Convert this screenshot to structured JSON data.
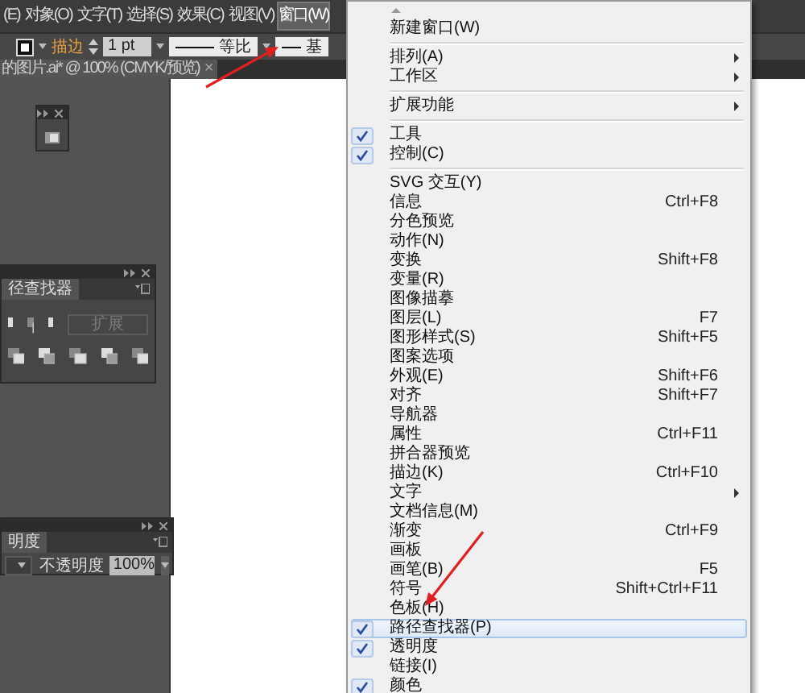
{
  "menubar": {
    "items": [
      {
        "label": "(E)",
        "selected": false
      },
      {
        "label": "对象(O)",
        "selected": false
      },
      {
        "label": "文字(T)",
        "selected": false
      },
      {
        "label": "选择(S)",
        "selected": false
      },
      {
        "label": "效果(C)",
        "selected": false
      },
      {
        "label": "视图(V)",
        "selected": false
      },
      {
        "label": "窗口(W)",
        "selected": true
      }
    ]
  },
  "control_bar": {
    "stroke_label": "描边",
    "stroke_weight": "1 pt",
    "profile_1": "等比",
    "profile_2": "基"
  },
  "document_tab": {
    "title": "的图片.ai* @ 100% (CMYK/预览)",
    "close": "×"
  },
  "pathfinder_panel": {
    "tab": "径查找器",
    "expand_button": {
      "label": "扩展",
      "disabled": true
    }
  },
  "transparency_panel": {
    "tab": "明度",
    "opacity_label": "不透明度",
    "opacity_value": "100%"
  },
  "window_menu": {
    "items": [
      {
        "kind": "item",
        "label": "新建窗口(W)",
        "checked": false,
        "selected": false
      },
      {
        "kind": "separator"
      },
      {
        "kind": "item",
        "label": "排列(A)",
        "submenu": true,
        "checked": false,
        "selected": false
      },
      {
        "kind": "item",
        "label": "工作区",
        "submenu": true,
        "checked": false,
        "selected": false
      },
      {
        "kind": "separator"
      },
      {
        "kind": "item",
        "label": "扩展功能",
        "submenu": true,
        "checked": false,
        "selected": false
      },
      {
        "kind": "separator"
      },
      {
        "kind": "item",
        "label": "工具",
        "checked": true,
        "selected": false
      },
      {
        "kind": "item",
        "label": "控制(C)",
        "checked": true,
        "selected": false
      },
      {
        "kind": "separator"
      },
      {
        "kind": "item",
        "label": "SVG 交互(Y)",
        "checked": false,
        "selected": false
      },
      {
        "kind": "item",
        "label": "信息",
        "shortcut": "Ctrl+F8",
        "checked": false,
        "selected": false
      },
      {
        "kind": "item",
        "label": "分色预览",
        "checked": false,
        "selected": false
      },
      {
        "kind": "item",
        "label": "动作(N)",
        "checked": false,
        "selected": false
      },
      {
        "kind": "item",
        "label": "变换",
        "shortcut": "Shift+F8",
        "checked": false,
        "selected": false
      },
      {
        "kind": "item",
        "label": "变量(R)",
        "checked": false,
        "selected": false
      },
      {
        "kind": "item",
        "label": "图像描摹",
        "checked": false,
        "selected": false
      },
      {
        "kind": "item",
        "label": "图层(L)",
        "shortcut": "F7",
        "checked": false,
        "selected": false
      },
      {
        "kind": "item",
        "label": "图形样式(S)",
        "shortcut": "Shift+F5",
        "checked": false,
        "selected": false
      },
      {
        "kind": "item",
        "label": "图案选项",
        "checked": false,
        "selected": false
      },
      {
        "kind": "item",
        "label": "外观(E)",
        "shortcut": "Shift+F6",
        "checked": false,
        "selected": false
      },
      {
        "kind": "item",
        "label": "对齐",
        "shortcut": "Shift+F7",
        "checked": false,
        "selected": false
      },
      {
        "kind": "item",
        "label": "导航器",
        "checked": false,
        "selected": false
      },
      {
        "kind": "item",
        "label": "属性",
        "shortcut": "Ctrl+F11",
        "checked": false,
        "selected": false
      },
      {
        "kind": "item",
        "label": "拼合器预览",
        "checked": false,
        "selected": false
      },
      {
        "kind": "item",
        "label": "描边(K)",
        "shortcut": "Ctrl+F10",
        "checked": false,
        "selected": false
      },
      {
        "kind": "item",
        "label": "文字",
        "submenu": true,
        "checked": false,
        "selected": false
      },
      {
        "kind": "item",
        "label": "文档信息(M)",
        "checked": false,
        "selected": false
      },
      {
        "kind": "item",
        "label": "渐变",
        "shortcut": "Ctrl+F9",
        "checked": false,
        "selected": false
      },
      {
        "kind": "item",
        "label": "画板",
        "checked": false,
        "selected": false
      },
      {
        "kind": "item",
        "label": "画笔(B)",
        "shortcut": "F5",
        "checked": false,
        "selected": false
      },
      {
        "kind": "item",
        "label": "符号",
        "shortcut": "Shift+Ctrl+F11",
        "checked": false,
        "selected": false
      },
      {
        "kind": "item",
        "label": "色板(H)",
        "checked": false,
        "selected": false
      },
      {
        "kind": "item",
        "label": "路径查找器(P)",
        "checked": true,
        "selected": true
      },
      {
        "kind": "item",
        "label": "透明度",
        "checked": true,
        "selected": false
      },
      {
        "kind": "item",
        "label": "链接(I)",
        "checked": false,
        "selected": false
      },
      {
        "kind": "item",
        "label": "颜色",
        "checked": true,
        "selected": false
      }
    ]
  }
}
